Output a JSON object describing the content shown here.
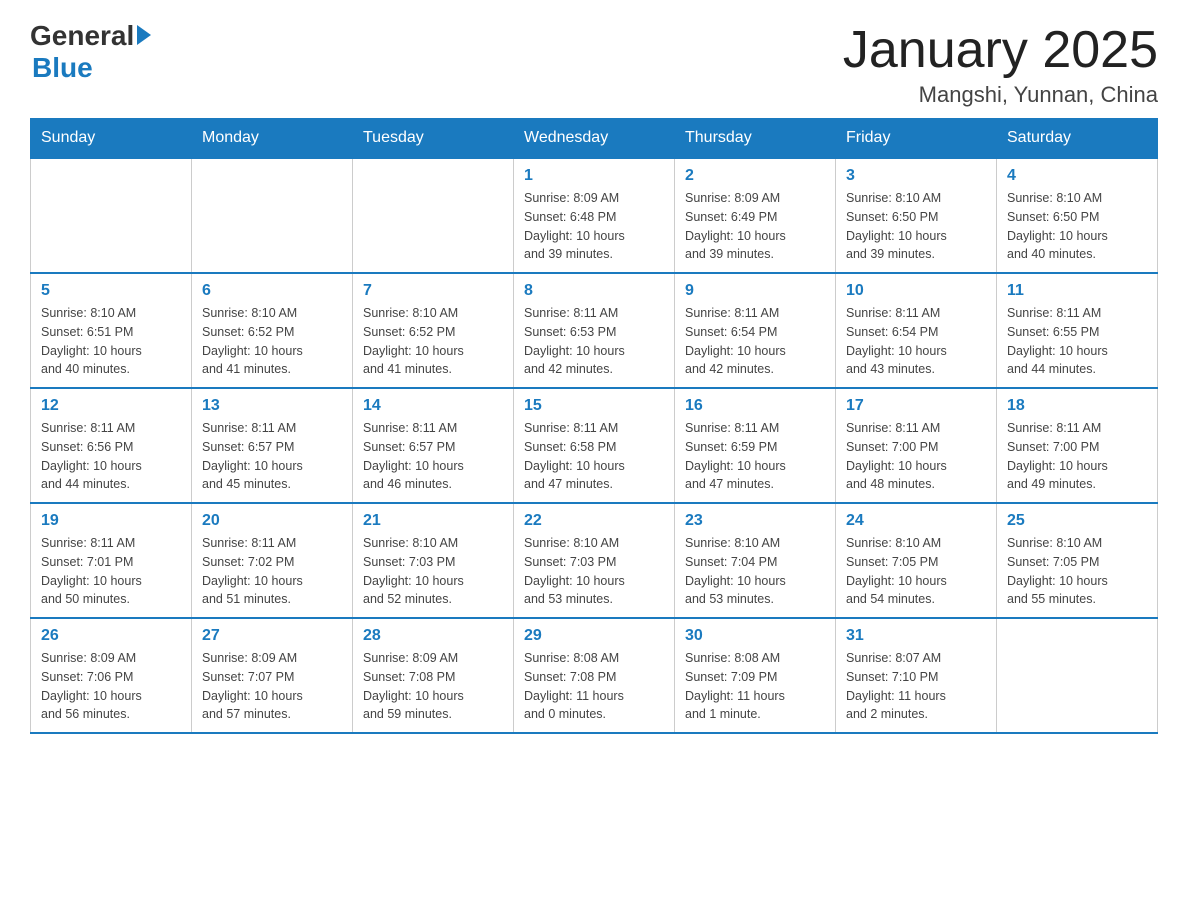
{
  "header": {
    "logo_general": "General",
    "logo_blue": "Blue",
    "month_title": "January 2025",
    "location": "Mangshi, Yunnan, China"
  },
  "days_of_week": [
    "Sunday",
    "Monday",
    "Tuesday",
    "Wednesday",
    "Thursday",
    "Friday",
    "Saturday"
  ],
  "weeks": [
    [
      {
        "day": "",
        "info": ""
      },
      {
        "day": "",
        "info": ""
      },
      {
        "day": "",
        "info": ""
      },
      {
        "day": "1",
        "info": "Sunrise: 8:09 AM\nSunset: 6:48 PM\nDaylight: 10 hours\nand 39 minutes."
      },
      {
        "day": "2",
        "info": "Sunrise: 8:09 AM\nSunset: 6:49 PM\nDaylight: 10 hours\nand 39 minutes."
      },
      {
        "day": "3",
        "info": "Sunrise: 8:10 AM\nSunset: 6:50 PM\nDaylight: 10 hours\nand 39 minutes."
      },
      {
        "day": "4",
        "info": "Sunrise: 8:10 AM\nSunset: 6:50 PM\nDaylight: 10 hours\nand 40 minutes."
      }
    ],
    [
      {
        "day": "5",
        "info": "Sunrise: 8:10 AM\nSunset: 6:51 PM\nDaylight: 10 hours\nand 40 minutes."
      },
      {
        "day": "6",
        "info": "Sunrise: 8:10 AM\nSunset: 6:52 PM\nDaylight: 10 hours\nand 41 minutes."
      },
      {
        "day": "7",
        "info": "Sunrise: 8:10 AM\nSunset: 6:52 PM\nDaylight: 10 hours\nand 41 minutes."
      },
      {
        "day": "8",
        "info": "Sunrise: 8:11 AM\nSunset: 6:53 PM\nDaylight: 10 hours\nand 42 minutes."
      },
      {
        "day": "9",
        "info": "Sunrise: 8:11 AM\nSunset: 6:54 PM\nDaylight: 10 hours\nand 42 minutes."
      },
      {
        "day": "10",
        "info": "Sunrise: 8:11 AM\nSunset: 6:54 PM\nDaylight: 10 hours\nand 43 minutes."
      },
      {
        "day": "11",
        "info": "Sunrise: 8:11 AM\nSunset: 6:55 PM\nDaylight: 10 hours\nand 44 minutes."
      }
    ],
    [
      {
        "day": "12",
        "info": "Sunrise: 8:11 AM\nSunset: 6:56 PM\nDaylight: 10 hours\nand 44 minutes."
      },
      {
        "day": "13",
        "info": "Sunrise: 8:11 AM\nSunset: 6:57 PM\nDaylight: 10 hours\nand 45 minutes."
      },
      {
        "day": "14",
        "info": "Sunrise: 8:11 AM\nSunset: 6:57 PM\nDaylight: 10 hours\nand 46 minutes."
      },
      {
        "day": "15",
        "info": "Sunrise: 8:11 AM\nSunset: 6:58 PM\nDaylight: 10 hours\nand 47 minutes."
      },
      {
        "day": "16",
        "info": "Sunrise: 8:11 AM\nSunset: 6:59 PM\nDaylight: 10 hours\nand 47 minutes."
      },
      {
        "day": "17",
        "info": "Sunrise: 8:11 AM\nSunset: 7:00 PM\nDaylight: 10 hours\nand 48 minutes."
      },
      {
        "day": "18",
        "info": "Sunrise: 8:11 AM\nSunset: 7:00 PM\nDaylight: 10 hours\nand 49 minutes."
      }
    ],
    [
      {
        "day": "19",
        "info": "Sunrise: 8:11 AM\nSunset: 7:01 PM\nDaylight: 10 hours\nand 50 minutes."
      },
      {
        "day": "20",
        "info": "Sunrise: 8:11 AM\nSunset: 7:02 PM\nDaylight: 10 hours\nand 51 minutes."
      },
      {
        "day": "21",
        "info": "Sunrise: 8:10 AM\nSunset: 7:03 PM\nDaylight: 10 hours\nand 52 minutes."
      },
      {
        "day": "22",
        "info": "Sunrise: 8:10 AM\nSunset: 7:03 PM\nDaylight: 10 hours\nand 53 minutes."
      },
      {
        "day": "23",
        "info": "Sunrise: 8:10 AM\nSunset: 7:04 PM\nDaylight: 10 hours\nand 53 minutes."
      },
      {
        "day": "24",
        "info": "Sunrise: 8:10 AM\nSunset: 7:05 PM\nDaylight: 10 hours\nand 54 minutes."
      },
      {
        "day": "25",
        "info": "Sunrise: 8:10 AM\nSunset: 7:05 PM\nDaylight: 10 hours\nand 55 minutes."
      }
    ],
    [
      {
        "day": "26",
        "info": "Sunrise: 8:09 AM\nSunset: 7:06 PM\nDaylight: 10 hours\nand 56 minutes."
      },
      {
        "day": "27",
        "info": "Sunrise: 8:09 AM\nSunset: 7:07 PM\nDaylight: 10 hours\nand 57 minutes."
      },
      {
        "day": "28",
        "info": "Sunrise: 8:09 AM\nSunset: 7:08 PM\nDaylight: 10 hours\nand 59 minutes."
      },
      {
        "day": "29",
        "info": "Sunrise: 8:08 AM\nSunset: 7:08 PM\nDaylight: 11 hours\nand 0 minutes."
      },
      {
        "day": "30",
        "info": "Sunrise: 8:08 AM\nSunset: 7:09 PM\nDaylight: 11 hours\nand 1 minute."
      },
      {
        "day": "31",
        "info": "Sunrise: 8:07 AM\nSunset: 7:10 PM\nDaylight: 11 hours\nand 2 minutes."
      },
      {
        "day": "",
        "info": ""
      }
    ]
  ]
}
